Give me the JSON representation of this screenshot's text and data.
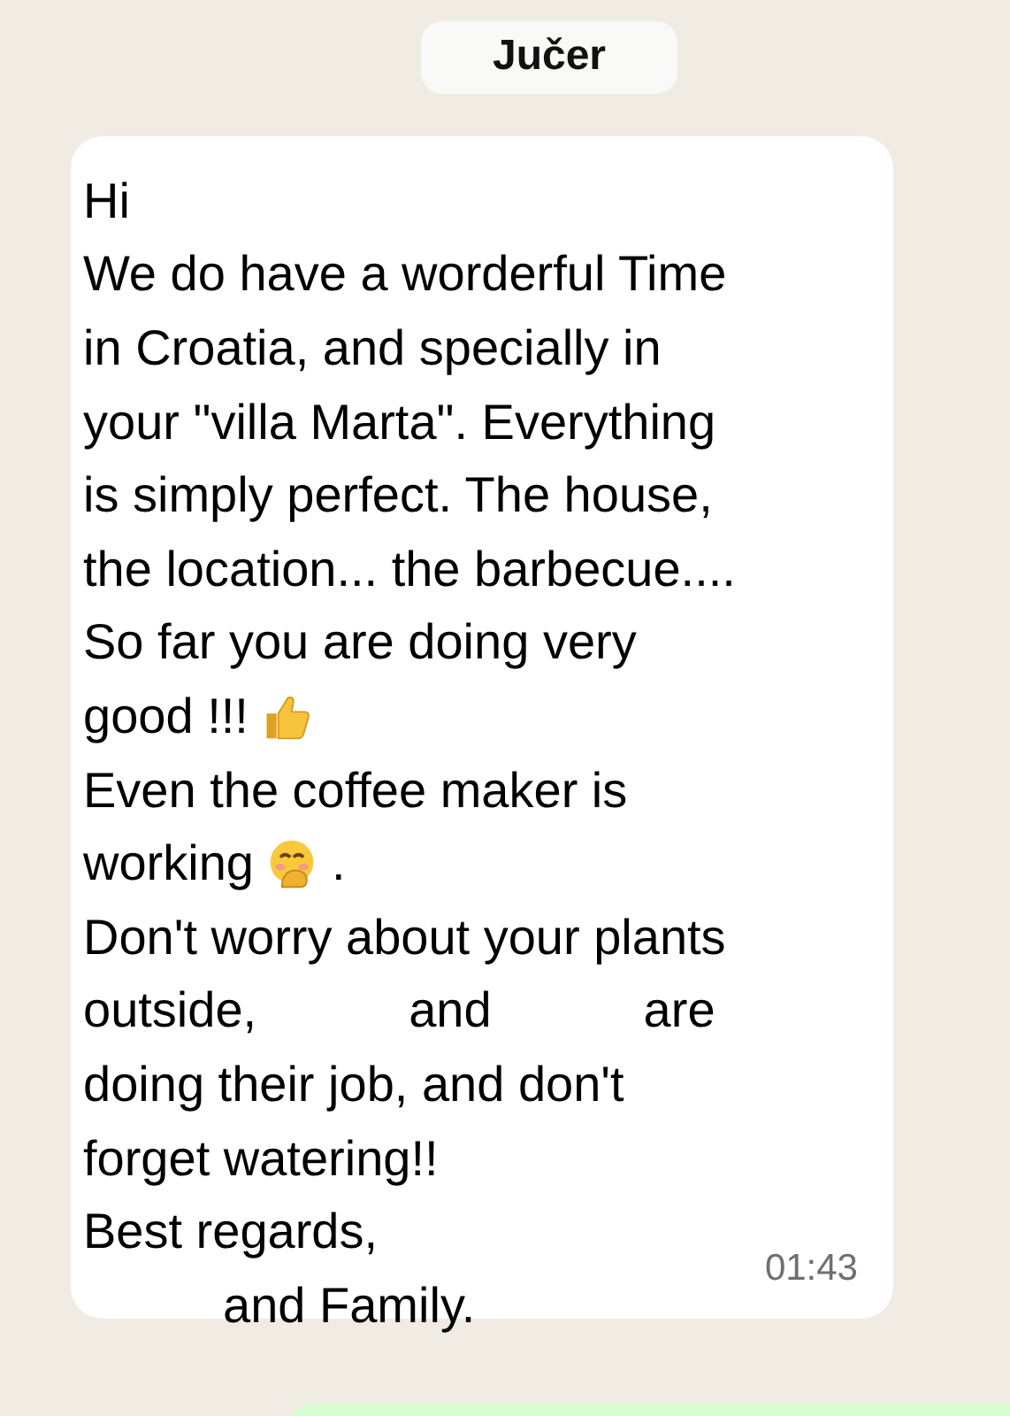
{
  "date_chip": "Jučer",
  "message": {
    "lines": [
      [
        {
          "kind": "text",
          "text": "Hi"
        },
        {
          "kind": "redacted"
        }
      ],
      [
        {
          "kind": "text",
          "text": "We do have a worderful Time"
        }
      ],
      [
        {
          "kind": "text",
          "text": "in Croatia, and specially in"
        }
      ],
      [
        {
          "kind": "text",
          "text": "your \"villa Marta\". Everything"
        }
      ],
      [
        {
          "kind": "text",
          "text": "is simply perfect. The house,"
        }
      ],
      [
        {
          "kind": "text",
          "text": "the location... the barbecue...."
        }
      ],
      [
        {
          "kind": "text",
          "text": "So far you are doing very"
        }
      ],
      [
        {
          "kind": "text",
          "text": "good !!!"
        },
        {
          "kind": "thumbs-up"
        }
      ],
      [
        {
          "kind": "text",
          "text": "Even the coffee maker is"
        }
      ],
      [
        {
          "kind": "text",
          "text": "working"
        },
        {
          "kind": "hand-over-mouth"
        },
        {
          "kind": "text",
          "text": "."
        }
      ],
      [
        {
          "kind": "text",
          "text": "Don't worry about your plants"
        }
      ],
      [
        {
          "kind": "text",
          "text": "outside,"
        },
        {
          "kind": "redacted"
        },
        {
          "kind": "text",
          "text": "and"
        },
        {
          "kind": "redacted"
        },
        {
          "kind": "text",
          "text": "are"
        }
      ],
      [
        {
          "kind": "text",
          "text": "doing their job, and don't"
        }
      ],
      [
        {
          "kind": "text",
          "text": "forget watering!!"
        }
      ],
      [
        {
          "kind": "text",
          "text": "Best regards,"
        }
      ],
      [
        {
          "kind": "redacted"
        },
        {
          "kind": "text",
          "text": "and Family."
        }
      ]
    ],
    "time": "01:43"
  }
}
